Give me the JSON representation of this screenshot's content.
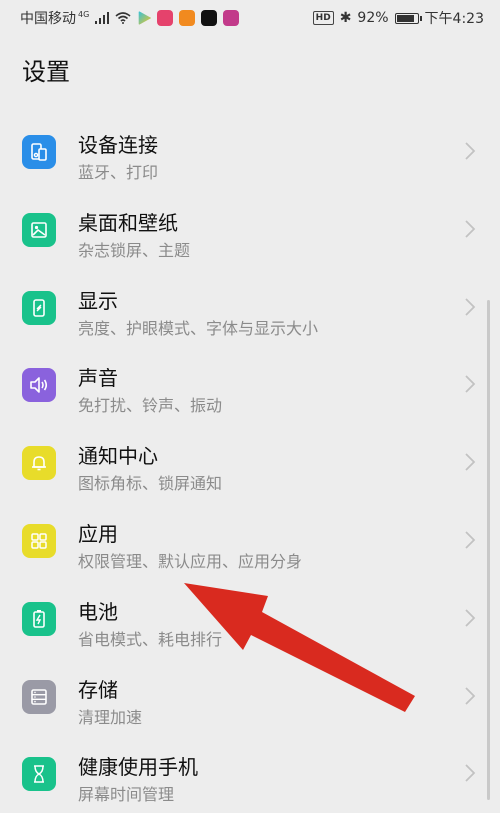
{
  "status_bar": {
    "carrier": "中国移动",
    "network": "4G",
    "battery_percent": "92%",
    "battery_level": 0.92,
    "time": "下午4:23",
    "hd": "HD"
  },
  "page_title": "设置",
  "items": [
    {
      "label": "设备连接",
      "sub": "蓝牙、打印",
      "icon": "device-connect-icon",
      "color": "#2a8ee8"
    },
    {
      "label": "桌面和壁纸",
      "sub": "杂志锁屏、主题",
      "icon": "wallpaper-icon",
      "color": "#19c28b"
    },
    {
      "label": "显示",
      "sub": "亮度、护眼模式、字体与显示大小",
      "icon": "display-icon",
      "color": "#19c28b"
    },
    {
      "label": "声音",
      "sub": "免打扰、铃声、振动",
      "icon": "speaker-icon",
      "color": "#8a62dd"
    },
    {
      "label": "通知中心",
      "sub": "图标角标、锁屏通知",
      "icon": "bell-icon",
      "color": "#e8dc2a"
    },
    {
      "label": "应用",
      "sub": "权限管理、默认应用、应用分身",
      "icon": "apps-grid-icon",
      "color": "#e8dc2a"
    },
    {
      "label": "电池",
      "sub": "省电模式、耗电排行",
      "icon": "battery-icon",
      "color": "#19c28b"
    },
    {
      "label": "存储",
      "sub": "清理加速",
      "icon": "storage-icon",
      "color": "#9a9aa6"
    },
    {
      "label": "健康使用手机",
      "sub": "屏幕时间管理",
      "icon": "hourglass-icon",
      "color": "#19c28b"
    }
  ],
  "annotation_color": "#d92a1f"
}
